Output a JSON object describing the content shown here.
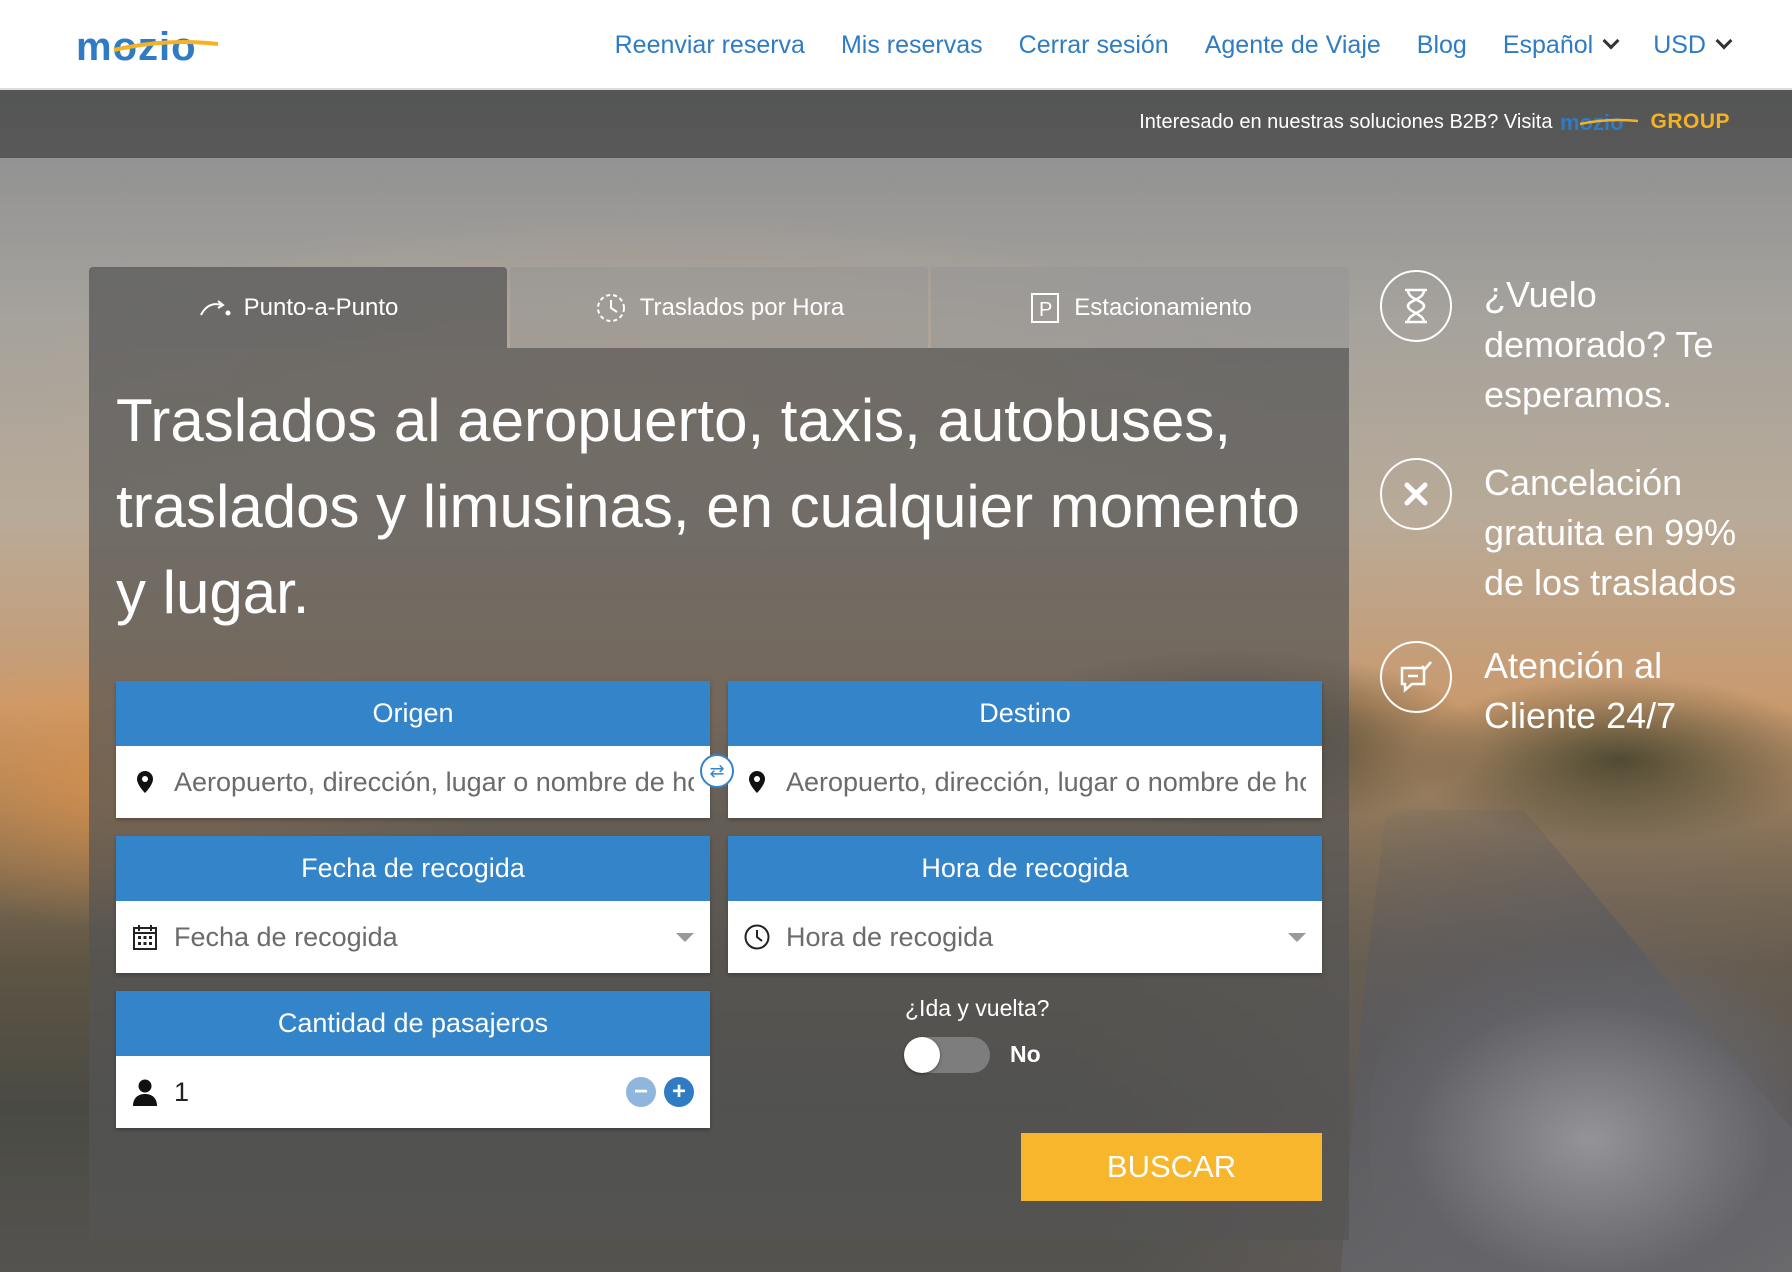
{
  "brand": {
    "logo": "mozio"
  },
  "nav": {
    "items": [
      "Reenviar reserva",
      "Mis reservas",
      "Cerrar sesión",
      "Agente de Viaje",
      "Blog"
    ],
    "language": "Español",
    "currency": "USD"
  },
  "b2b": {
    "text": "Interesado en nuestras soluciones B2B? Visita",
    "logo_main": "mozio",
    "logo_group": "GROUP"
  },
  "tabs": [
    {
      "label": "Punto-a-Punto",
      "icon": "route-arrow-icon",
      "active": true
    },
    {
      "label": "Traslados por Hora",
      "icon": "clock-dashed-icon",
      "active": false
    },
    {
      "label": "Estacionamiento",
      "icon": "parking-icon",
      "active": false
    }
  ],
  "headline": "Traslados al aeropuerto, taxis, autobuses, traslados y limusinas, en cualquier momento y lugar.",
  "form": {
    "origin": {
      "label": "Origen",
      "placeholder": "Aeropuerto, dirección, lugar o nombre de hotel"
    },
    "destination": {
      "label": "Destino",
      "placeholder": "Aeropuerto, dirección, lugar o nombre de hotel"
    },
    "date": {
      "label": "Fecha de recogida",
      "placeholder": "Fecha de recogida"
    },
    "time": {
      "label": "Hora de recogida",
      "placeholder": "Hora de recogida"
    },
    "passengers": {
      "label": "Cantidad de pasajeros",
      "value": "1"
    },
    "round_trip": {
      "label": "¿Ida y vuelta?",
      "value": "No"
    },
    "search_button": "BUSCAR"
  },
  "features": [
    {
      "text": "¿Vuelo demorado? Te esperamos.",
      "icon": "hourglass-icon"
    },
    {
      "text": "Cancelación gratuita en 99% de los traslados",
      "icon": "close-circle-icon"
    },
    {
      "text": "Atención al Cliente 24/7",
      "icon": "chat-support-icon"
    }
  ],
  "colors": {
    "brand_blue": "#3484c9",
    "accent_yellow": "#f8b62d",
    "nav_blue": "#2f7bc4"
  }
}
